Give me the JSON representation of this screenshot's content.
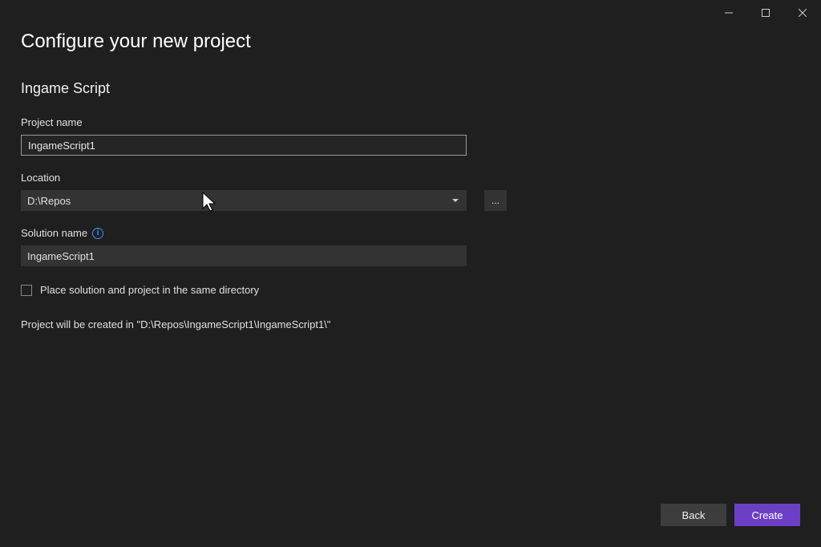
{
  "window": {
    "title": "Configure your new project",
    "template": "Ingame Script"
  },
  "fields": {
    "projectName": {
      "label": "Project name",
      "value": "IngameScript1"
    },
    "location": {
      "label": "Location",
      "value": "D:\\Repos",
      "browse": "..."
    },
    "solutionName": {
      "label": "Solution name",
      "value": "IngameScript1"
    },
    "sameDirectory": {
      "label": "Place solution and project in the same directory",
      "checked": false
    }
  },
  "pathInfo": "Project will be created in \"D:\\Repos\\IngameScript1\\IngameScript1\\\"",
  "buttons": {
    "back": "Back",
    "create": "Create"
  }
}
